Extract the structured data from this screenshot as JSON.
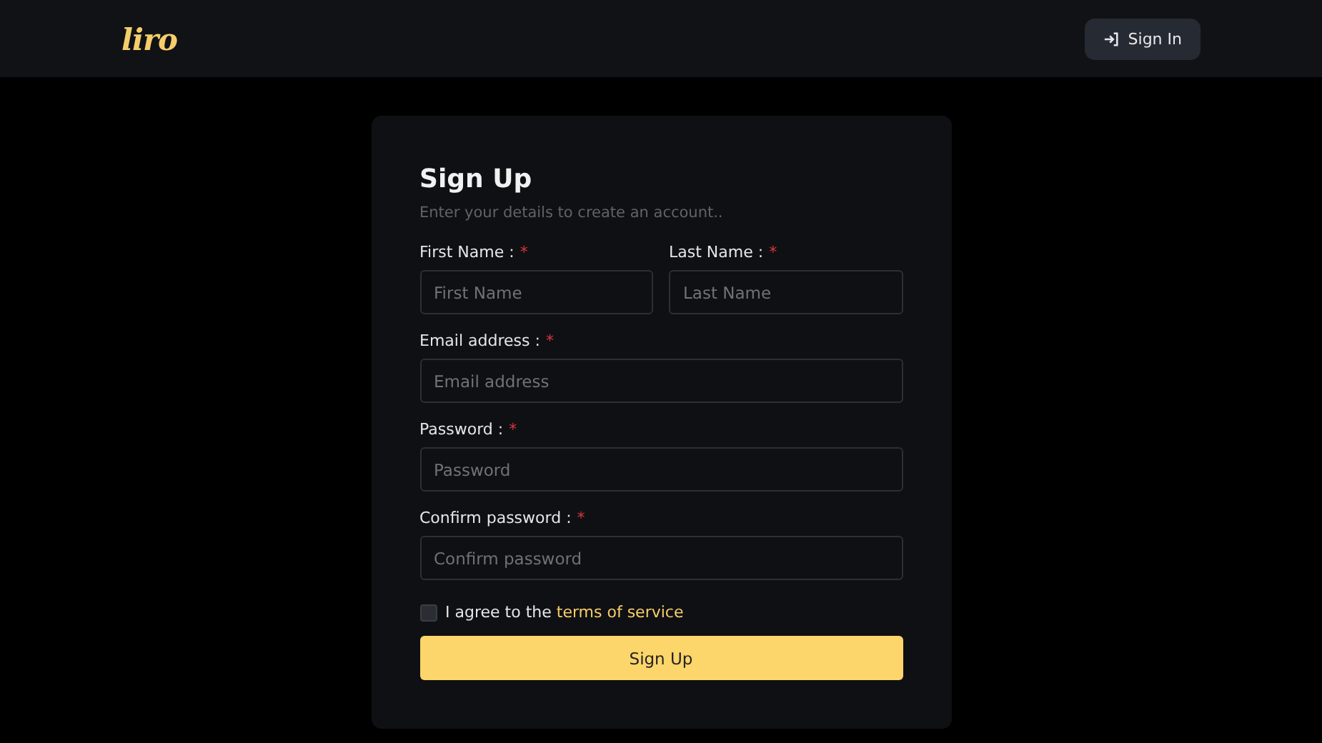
{
  "header": {
    "logo": "liro",
    "sign_in_button": "Sign In"
  },
  "form": {
    "title": "Sign Up",
    "subtitle": "Enter your details to create an account..",
    "rows": [
      [
        {
          "label": "First Name :",
          "required_mark": "*",
          "placeholder": "First Name"
        },
        {
          "label": "Last Name :",
          "required_mark": "*",
          "placeholder": "Last Name"
        }
      ],
      [
        {
          "label": "Email address :",
          "required_mark": "*",
          "placeholder": "Email address"
        }
      ],
      [
        {
          "label": "Password :",
          "required_mark": "*",
          "placeholder": "Password"
        }
      ],
      [
        {
          "label": "Confirm password :",
          "required_mark": "*",
          "placeholder": "Confirm password"
        }
      ]
    ],
    "agree": {
      "checked": false,
      "text": "I agree to the",
      "link": "terms of service"
    },
    "submit": "Sign Up"
  }
}
